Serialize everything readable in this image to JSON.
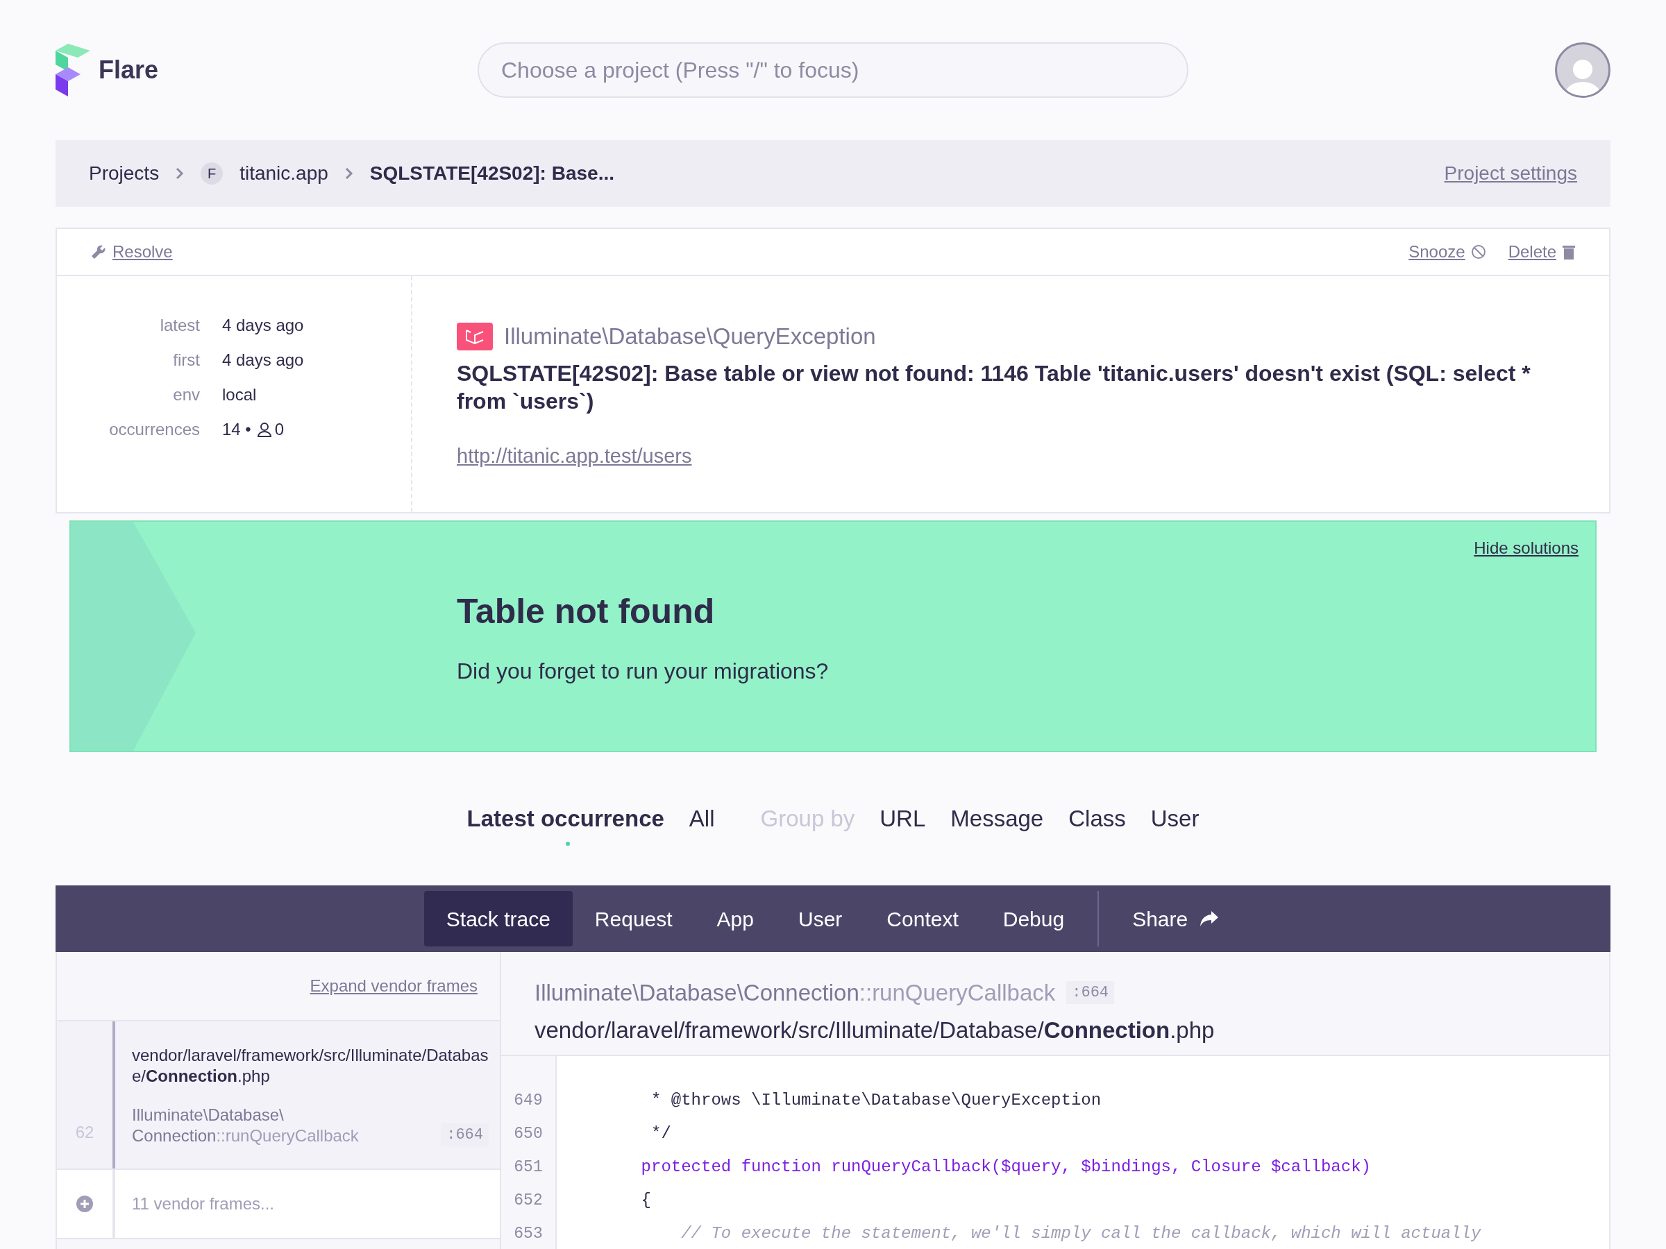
{
  "brand": {
    "name": "Flare"
  },
  "search": {
    "placeholder": "Choose a project (Press \"/\" to focus)"
  },
  "breadcrumb": {
    "items": [
      {
        "kind": "plain",
        "label": "Projects"
      },
      {
        "kind": "project",
        "badge": "F",
        "label": "titanic.app"
      },
      {
        "kind": "current",
        "label": "SQLSTATE[42S02]: Base..."
      }
    ],
    "settings_link": "Project settings"
  },
  "actions": {
    "resolve": "Resolve",
    "snooze": "Snooze",
    "delete": "Delete"
  },
  "meta": [
    {
      "label": "latest",
      "value": "4 days ago"
    },
    {
      "label": "first",
      "value": "4 days ago"
    },
    {
      "label": "env",
      "value": "local"
    },
    {
      "label": "occurrences",
      "value": "14 •",
      "users": "0"
    }
  ],
  "error": {
    "class": "Illuminate\\Database\\QueryException",
    "message": "SQLSTATE[42S02]: Base table or view not found: 1146 Table 'titanic.users' doesn't exist (SQL: select * from `users`)",
    "url": "http://titanic.app.test/users"
  },
  "solution": {
    "hide": "Hide solutions",
    "title": "Table not found",
    "text": "Did you forget to run your migrations?"
  },
  "occurrence_tabs": [
    {
      "kind": "tab",
      "label": "Latest occurrence",
      "selected": true
    },
    {
      "kind": "tab",
      "label": "All",
      "selected": false
    },
    {
      "kind": "label",
      "label": "Group by"
    },
    {
      "kind": "tab",
      "label": "URL",
      "selected": false
    },
    {
      "kind": "tab",
      "label": "Message",
      "selected": false
    },
    {
      "kind": "tab",
      "label": "Class",
      "selected": false
    },
    {
      "kind": "tab",
      "label": "User",
      "selected": false
    }
  ],
  "nav_tabs": [
    {
      "label": "Stack trace",
      "selected": true
    },
    {
      "label": "Request",
      "selected": false
    },
    {
      "label": "App",
      "selected": false
    },
    {
      "label": "User",
      "selected": false
    },
    {
      "label": "Context",
      "selected": false
    },
    {
      "label": "Debug",
      "selected": false
    }
  ],
  "share": "Share",
  "frames": {
    "expand": "Expand vendor frames",
    "items": [
      {
        "kind": "frame",
        "number": "62",
        "path": "vendor/laravel/framework/src/Illuminate/Database/**Connection**.php",
        "class": "Illuminate\\Database\\",
        "method_class": "Connection",
        "method": "::runQueryCallback",
        "line": ":664",
        "selected": true
      },
      {
        "kind": "vendor",
        "label": "11 vendor frames..."
      }
    ]
  },
  "code": {
    "class": "Illuminate\\Database\\Connection",
    "method": "::runQueryCallback",
    "line": ":664",
    "path": "vendor/laravel/framework/src/Illuminate/Database/**Connection**.php",
    "lines": [
      {
        "number": "649",
        "kind": "comment_doc",
        "text": "     * @throws \\Illuminate\\Database\\QueryException"
      },
      {
        "number": "650",
        "kind": "comment_doc",
        "text": "     */"
      },
      {
        "number": "651",
        "kind": "keyword",
        "text": "    protected function runQueryCallback($query, $bindings, Closure $callback)"
      },
      {
        "number": "652",
        "kind": "plain",
        "text": "    {"
      },
      {
        "number": "653",
        "kind": "comment",
        "text": "        // To execute the statement, we'll simply call the callback, which will actually"
      }
    ]
  }
}
